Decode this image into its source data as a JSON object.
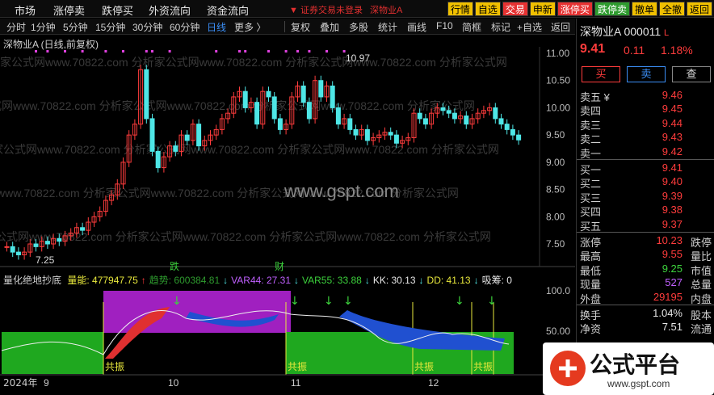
{
  "menubar": {
    "items": [
      "市场",
      "涨停卖",
      "跌停买",
      "外资流向",
      "资金流向"
    ],
    "notice": "▼ 证券交易未登录",
    "stock_short": "深物业A",
    "quick_buttons": [
      {
        "label": "行情",
        "bg": "#f0c000",
        "fg": "#000"
      },
      {
        "label": "自选",
        "bg": "#f0c000",
        "fg": "#000"
      },
      {
        "label": "交易",
        "bg": "#e63232",
        "fg": "#fff"
      },
      {
        "label": "申新",
        "bg": "#f0c000",
        "fg": "#000"
      },
      {
        "label": "涨停买",
        "bg": "#e63232",
        "fg": "#fff"
      },
      {
        "label": "跌停卖",
        "bg": "#2e9b2e",
        "fg": "#fff"
      },
      {
        "label": "撤单",
        "bg": "#f0c000",
        "fg": "#000"
      },
      {
        "label": "全撤",
        "bg": "#f0c000",
        "fg": "#000"
      },
      {
        "label": "返回",
        "bg": "#f0c000",
        "fg": "#000"
      }
    ]
  },
  "toolbar": {
    "items": [
      "分时",
      "1分钟",
      "5分钟",
      "15分钟",
      "30分钟",
      "60分钟",
      "日线",
      "更多 〉"
    ],
    "active": "日线",
    "right_items": [
      "复权",
      "叠加",
      "多股",
      "统计",
      "画线",
      "F10",
      "简框",
      "标记",
      "+自选",
      "返回"
    ]
  },
  "chart_title": "深物业A (日线,前复权)",
  "price_axis": [
    "11.00",
    "10.50",
    "10.00",
    "9.50",
    "9.00",
    "8.50",
    "8.00",
    "7.50"
  ],
  "high_label": "10.97",
  "low_label": "7.25",
  "watermark": "www.gspt.com",
  "event_labels": [
    "跌",
    "财"
  ],
  "indicator": {
    "name": "量化绝地抄底",
    "values": [
      {
        "label": "量能: 477947.75",
        "arrow": "↑",
        "color": "#e8e83c",
        "arrow_color": "#ff3c3c"
      },
      {
        "label": "趋势: 600384.81",
        "arrow": "↓",
        "color": "#2e9b2e",
        "arrow_color": "#4ee6e6"
      },
      {
        "label": "VAR44: 27.31",
        "arrow": "↓",
        "color": "#c060ff",
        "arrow_color": "#4ee6e6"
      },
      {
        "label": "VAR55: 33.88",
        "arrow": "↓",
        "color": "#3cd23c",
        "arrow_color": "#4ee6e6"
      },
      {
        "label": "KK: 30.13",
        "arrow": "↓",
        "color": "#e8e8e8",
        "arrow_color": "#4ee6e6"
      },
      {
        "label": "DD: 41.13",
        "arrow": "↓",
        "color": "#e8e83c",
        "arrow_color": "#4ee6e6"
      },
      {
        "label": "吸筹: 0",
        "arrow": "",
        "color": "#e8e8e8",
        "arrow_color": "#e8e8e8"
      }
    ],
    "axis": [
      "100.0",
      "50.00"
    ],
    "signal_label": "共振"
  },
  "date_axis": [
    "2024年",
    "9",
    "10",
    "11",
    "12"
  ],
  "quote": {
    "name": "深物业A",
    "code": "000011",
    "price": "9.41",
    "change": "0.11",
    "pct": "1.18%",
    "buy_btn": "买",
    "sell_btn": "卖",
    "query_btn": "查",
    "asks": [
      {
        "label": "卖五 ¥",
        "price": "9.46",
        "vol": "",
        "color": "#ff3c3c"
      },
      {
        "label": "卖四",
        "price": "9.45",
        "vol": "",
        "color": "#ff3c3c"
      },
      {
        "label": "卖三",
        "price": "9.44",
        "vol": "",
        "color": "#ff3c3c"
      },
      {
        "label": "卖二",
        "price": "9.43",
        "vol": "",
        "color": "#ff3c3c"
      },
      {
        "label": "卖一",
        "price": "9.42",
        "vol": "",
        "color": "#ff3c3c"
      }
    ],
    "bids": [
      {
        "label": "买一",
        "price": "9.41",
        "color": "#ff3c3c"
      },
      {
        "label": "买二",
        "price": "9.40",
        "color": "#ff3c3c"
      },
      {
        "label": "买三",
        "price": "9.39",
        "color": "#ff3c3c"
      },
      {
        "label": "买四",
        "price": "9.38",
        "color": "#ff3c3c"
      },
      {
        "label": "买五",
        "price": "9.37",
        "color": "#ff3c3c"
      }
    ],
    "stats": [
      {
        "label": "涨停",
        "value": "10.23",
        "value_color": "#ff3c3c",
        "label2": "跌停"
      },
      {
        "label": "最高",
        "value": "9.55",
        "value_color": "#ff3c3c",
        "label2": "量比"
      },
      {
        "label": "最低",
        "value": "9.25",
        "value_color": "#3cd23c",
        "label2": "市值"
      },
      {
        "label": "现量",
        "value": "527",
        "value_color": "#c060ff",
        "label2": "总量"
      },
      {
        "label": "外盘",
        "value": "29195",
        "value_color": "#ff3c3c",
        "label2": "内盘"
      }
    ],
    "stats2": [
      {
        "label": "换手",
        "value": "1.04%",
        "value_color": "#e8e8e8",
        "label2": "股本"
      },
      {
        "label": "净资",
        "value": "7.51",
        "value_color": "#e8e8e8",
        "label2": "流通"
      }
    ]
  },
  "logo": {
    "text": "公式平台",
    "url": "www.gspt.com"
  }
}
